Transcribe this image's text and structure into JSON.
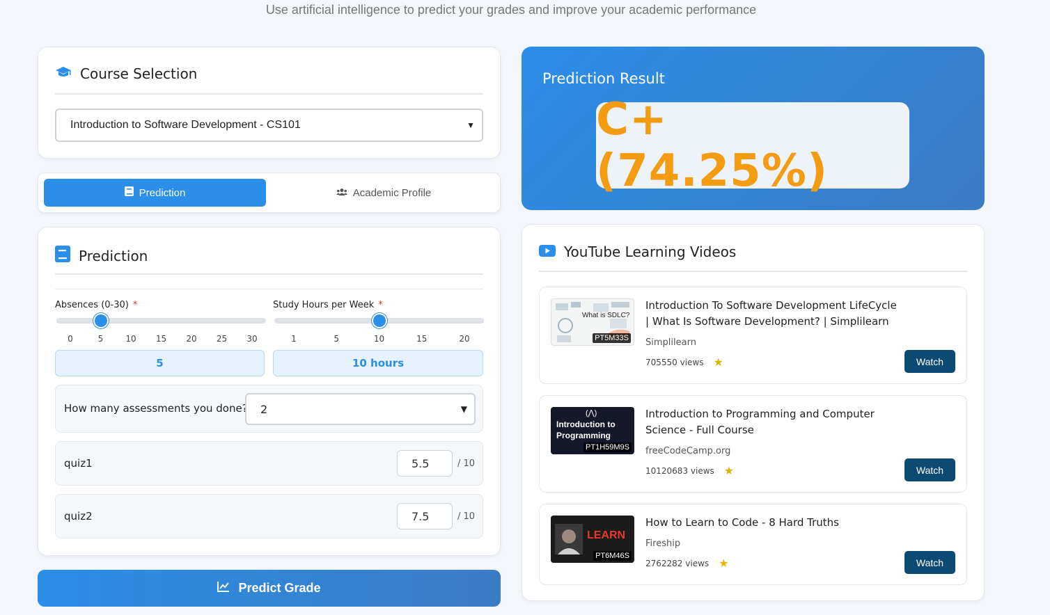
{
  "subtitle": "Use artificial intelligence to predict your grades and improve your academic performance",
  "course": {
    "title": "Course Selection",
    "selected": "Introduction to Software Development - CS101"
  },
  "tabs": [
    {
      "label": "Prediction",
      "active": true
    },
    {
      "label": "Academic Profile",
      "active": false
    }
  ],
  "prediction": {
    "title": "Prediction",
    "absences": {
      "label": "Absences (0-30)",
      "required_mark": "*",
      "ticks": [
        "0",
        "5",
        "10",
        "15",
        "20",
        "25",
        "30"
      ],
      "value": 5,
      "display": "5"
    },
    "study_hours": {
      "label": "Study Hours per Week",
      "required_mark": "*",
      "ticks": [
        "1",
        "5",
        "10",
        "15",
        "20"
      ],
      "value": 10,
      "display": "10 hours"
    },
    "assessments": {
      "label": "How many assessments you done?",
      "selected": "2"
    },
    "quizzes": [
      {
        "name": "quiz1",
        "score": "5.5",
        "max": "/ 10"
      },
      {
        "name": "quiz2",
        "score": "7.5",
        "max": "/ 10"
      }
    ],
    "button_label": "Predict Grade"
  },
  "result": {
    "title": "Prediction Result",
    "grade": "C+ (74.25%)"
  },
  "videos": {
    "title": "YouTube Learning Videos",
    "items": [
      {
        "title": "Introduction To Software Development LifeCycle | What Is Software Development? | Simplilearn",
        "channel": "Simplilearn",
        "views": "705550 views",
        "duration": "PT5M33S",
        "thumb_text": "What is SDLC?",
        "button": "Watch"
      },
      {
        "title": "Introduction to Programming and Computer Science - Full Course",
        "channel": "freeCodeCamp.org",
        "views": "10120683 views",
        "duration": "PT1H59M9S",
        "thumb_text": "Introduction to Programming",
        "button": "Watch"
      },
      {
        "title": "How to Learn to Code - 8 Hard Truths",
        "channel": "Fireship",
        "views": "2762282 views",
        "duration": "PT6M46S",
        "thumb_text": "LEARN",
        "button": "Watch"
      }
    ]
  },
  "colors": {
    "accent": "#2b8ee9",
    "grade": "#f39c12",
    "watch_button": "#0d4a73"
  }
}
